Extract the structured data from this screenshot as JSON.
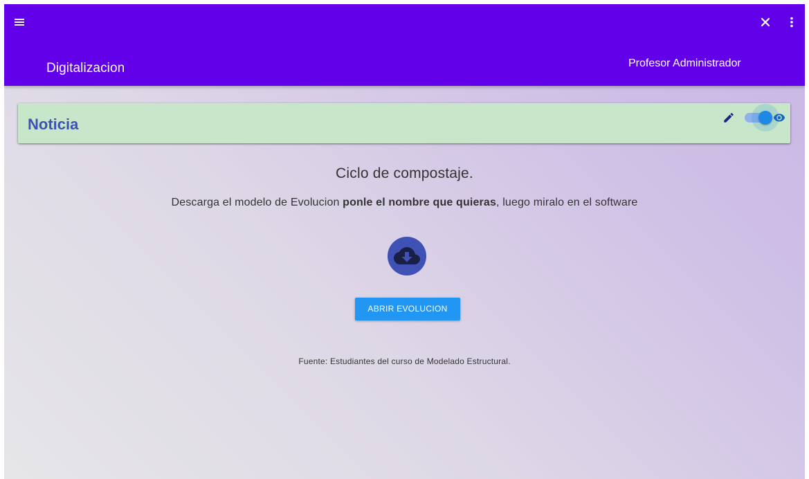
{
  "appbar": {
    "title": "Digitalizacion",
    "user": "Profesor Administrador",
    "icons": [
      "menu-icon",
      "close-icon",
      "more-vert-icon"
    ],
    "color": "#6200ea"
  },
  "news": {
    "title": "Noticia",
    "background": "#c8e6c9",
    "visible_toggle": true,
    "icons": [
      "edit-icon",
      "visibility-icon"
    ]
  },
  "content": {
    "title": "Ciclo de compostaje.",
    "description_prefix": "Descarga el modelo de Evolucion ",
    "description_bold": "ponle el nombre que quieras",
    "description_suffix": ", luego miralo en el software",
    "button_label": "ABRIR EVOLUCION",
    "source": "Fuente: Estudiantes del curso de Modelado Estructural.",
    "download_icon": "cloud-download-icon"
  }
}
